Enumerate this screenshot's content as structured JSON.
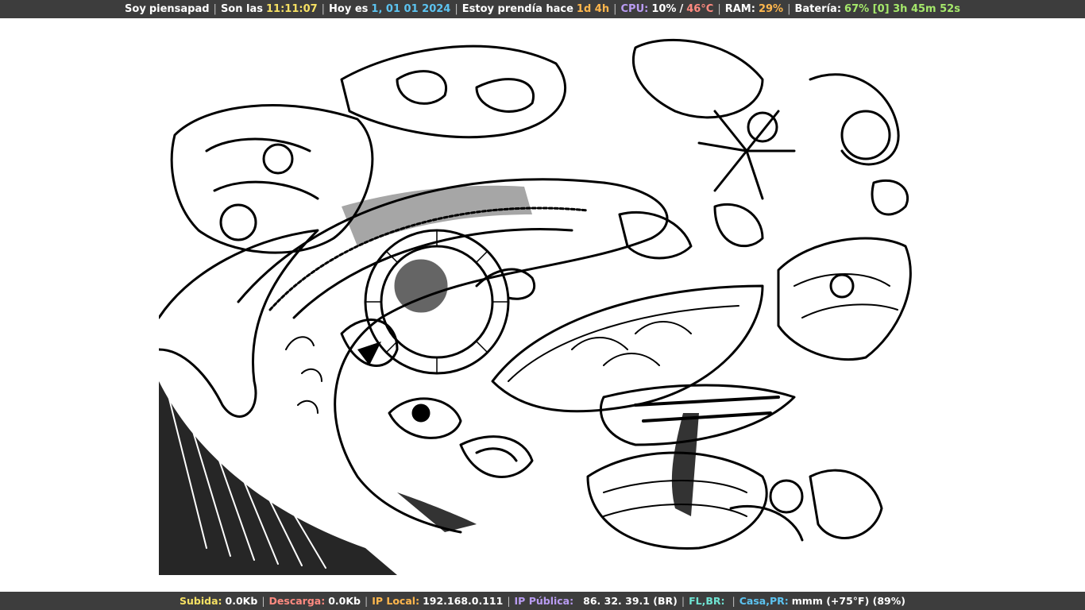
{
  "top_bar": {
    "user_prefix": "Soy",
    "username": "piensapad",
    "time_prefix": "Son las",
    "time": "11:11:07",
    "date_prefix": "Hoy es",
    "date": "1, 01 01 2024",
    "uptime_prefix": "Estoy prendía hace",
    "uptime": "1d 4h",
    "cpu_label": "CPU:",
    "cpu_value": "10%",
    "cpu_slash": "/",
    "cpu_temp": "46°C",
    "ram_label": "RAM:",
    "ram_value": "29%",
    "battery_label": "Batería:",
    "battery_value": "67% [0] 3h 45m 52s"
  },
  "bottom_bar": {
    "upload_label": "Subida:",
    "upload_value": "0.0Kb",
    "download_label": "Descarga:",
    "download_value": "0.0Kb",
    "local_ip_label": "IP Local:",
    "local_ip_value": "192.168.0.111",
    "public_ip_label": "IP Pública:",
    "public_ip_value": "86. 32. 39.1 (BR)",
    "weather1_label": "FL,BR:",
    "weather1_value": "",
    "weather2_label": "Casa,PR:",
    "weather2_value": "mmm (+75°F) (89%)"
  },
  "separator": "|",
  "colors": {
    "bar_background": "#3d3d3d",
    "yellow": "#f5e063",
    "blue": "#5cc3f0",
    "purple": "#b99cf2",
    "red": "#ff8a80",
    "orange": "#ffb74d",
    "green": "#a5e86b",
    "cyan": "#6fe3d2"
  },
  "wallpaper": {
    "description_icon": "line-art-wallpaper-icon"
  }
}
